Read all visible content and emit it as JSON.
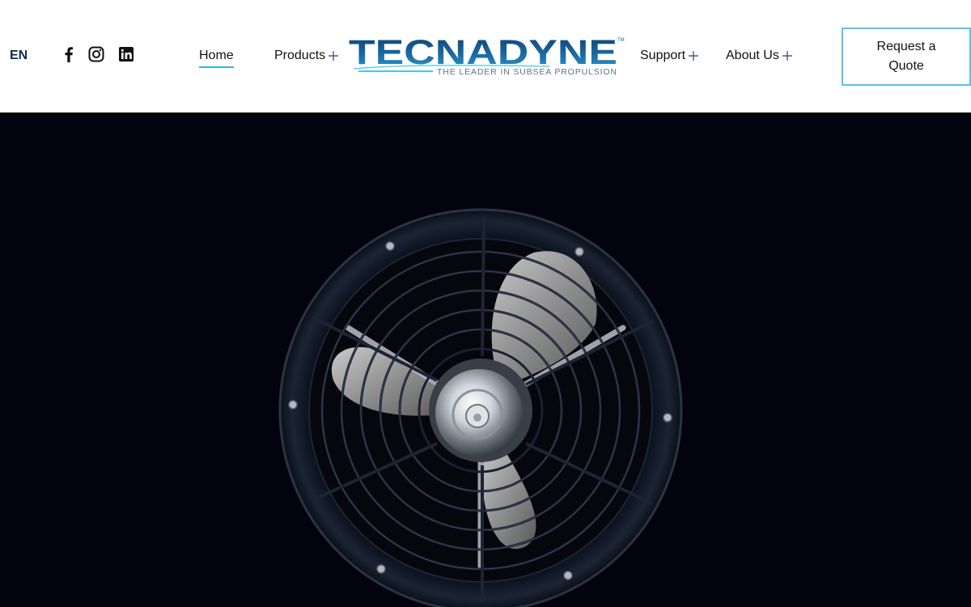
{
  "header": {
    "language": "EN",
    "social_links": [
      {
        "name": "facebook",
        "icon": "facebook-icon"
      },
      {
        "name": "instagram",
        "icon": "instagram-icon"
      },
      {
        "name": "linkedin",
        "icon": "linkedin-icon"
      }
    ],
    "nav": {
      "home": "Home",
      "products": "Products",
      "support": "Support",
      "about": "About Us",
      "active": "Home"
    },
    "logo": {
      "brand": "TECNADYNE",
      "trademark": "TM",
      "tagline": "THE LEADER IN SUBSEA PROPULSION"
    },
    "cta": {
      "label": "Request a Quote"
    }
  },
  "hero": {
    "image": "subsea-thruster-front-view"
  },
  "colors": {
    "accent": "#35b6d6",
    "cta_border": "#55c4e6",
    "logo_blue": "#1a5f96",
    "logo_light": "#4ec3e6",
    "hero_bg": "#02030f",
    "lang_color": "#0f2a55"
  }
}
